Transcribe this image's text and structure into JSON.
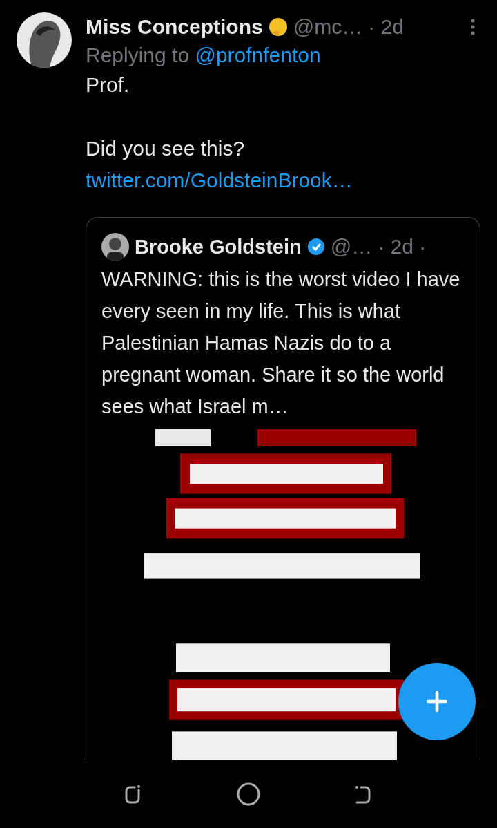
{
  "tweet": {
    "author_name": "Miss Conceptions",
    "handle": "@mc…",
    "time": "· 2d",
    "replying_label": "Replying to",
    "replying_to": "@profnfenton",
    "body_lines": [
      "Prof.",
      "Did you see this?"
    ],
    "link": "twitter.com/GoldsteinBrook…",
    "quoted": {
      "author_name": "Brooke Goldstein",
      "verified": true,
      "handle": "@…",
      "time": "· 2d ·",
      "text": "WARNING: this is the worst video I have every seen in my life. This is what Palestinian Hamas Nazis do to a pregnant woman. Share it so the world sees what Israel m…"
    }
  }
}
